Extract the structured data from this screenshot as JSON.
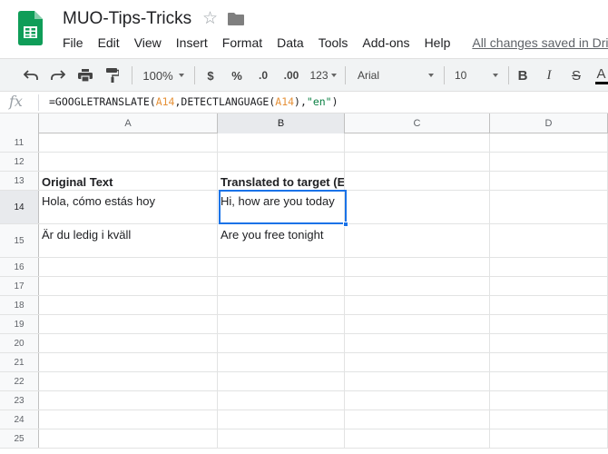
{
  "header": {
    "title": "MUO-Tips-Tricks",
    "menu": [
      "File",
      "Edit",
      "View",
      "Insert",
      "Format",
      "Data",
      "Tools",
      "Add-ons",
      "Help"
    ],
    "save_status": "All changes saved in Drive"
  },
  "toolbar": {
    "zoom": "100%",
    "currency": "$",
    "percent": "%",
    "decrease_decimals": ".0",
    "increase_decimals": ".00",
    "more_formats": "123",
    "font": "Arial",
    "font_size": "10",
    "bold": "B",
    "italic": "I",
    "strikethrough": "S",
    "text_color": "A"
  },
  "formula_bar": {
    "fx": "fx",
    "formula_parts": [
      {
        "text": "=GOOGLETRANSLATE(",
        "kind": "plain"
      },
      {
        "text": "A14",
        "kind": "ref"
      },
      {
        "text": ",DETECTLANGUAGE(",
        "kind": "plain"
      },
      {
        "text": "A14",
        "kind": "ref"
      },
      {
        "text": "),",
        "kind": "plain"
      },
      {
        "text": "\"en\"",
        "kind": "str"
      },
      {
        "text": ")",
        "kind": "plain"
      }
    ]
  },
  "grid": {
    "columns": [
      "A",
      "B",
      "C",
      "D"
    ],
    "selected_column": "B",
    "selected_row": "14",
    "rows": [
      {
        "num": "11",
        "cells": [
          "",
          "",
          "",
          ""
        ]
      },
      {
        "num": "12",
        "cells": [
          "",
          "",
          "",
          ""
        ]
      },
      {
        "num": "13",
        "cells": [
          "Original Text",
          "Translated to target (English)",
          "",
          ""
        ],
        "bold": true
      },
      {
        "num": "14",
        "cells": [
          "Hola, cómo estás hoy",
          "Hi, how are you today",
          "",
          ""
        ]
      },
      {
        "num": "15",
        "cells": [
          "Är du ledig i kväll",
          "Are you free tonight",
          "",
          ""
        ]
      },
      {
        "num": "16",
        "cells": [
          "",
          "",
          "",
          ""
        ]
      },
      {
        "num": "17",
        "cells": [
          "",
          "",
          "",
          ""
        ]
      },
      {
        "num": "18",
        "cells": [
          "",
          "",
          "",
          ""
        ]
      },
      {
        "num": "19",
        "cells": [
          "",
          "",
          "",
          ""
        ]
      },
      {
        "num": "20",
        "cells": [
          "",
          "",
          "",
          ""
        ]
      },
      {
        "num": "21",
        "cells": [
          "",
          "",
          "",
          ""
        ]
      },
      {
        "num": "22",
        "cells": [
          "",
          "",
          "",
          ""
        ]
      },
      {
        "num": "23",
        "cells": [
          "",
          "",
          "",
          ""
        ]
      },
      {
        "num": "24",
        "cells": [
          "",
          "",
          "",
          ""
        ]
      },
      {
        "num": "25",
        "cells": [
          "",
          "",
          "",
          ""
        ]
      }
    ]
  },
  "colors": {
    "sheets_green": "#0f9d58",
    "selection_blue": "#1a73e8",
    "formula_ref": "#e69138",
    "formula_string": "#0b8043"
  }
}
